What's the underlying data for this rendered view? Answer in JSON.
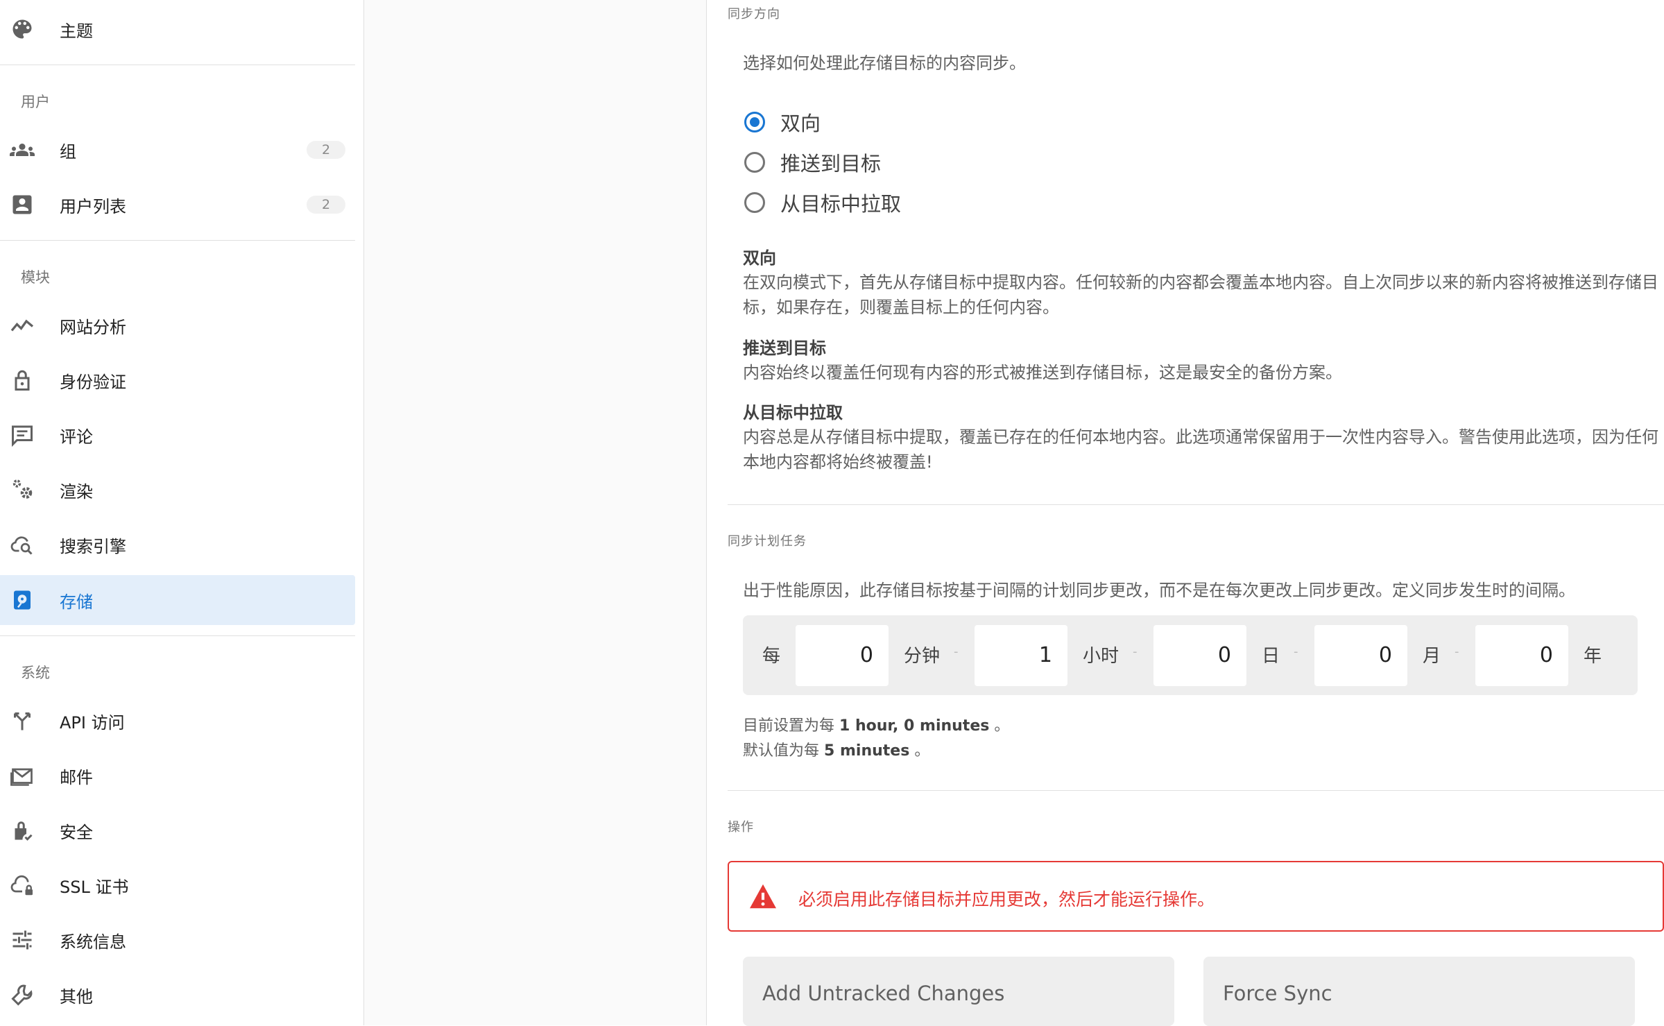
{
  "sidebar": {
    "theme_label": "主题",
    "users_header": "用户",
    "groups_label": "组",
    "groups_count": "2",
    "userlist_label": "用户列表",
    "userlist_count": "2",
    "modules_header": "模块",
    "analytics_label": "网站分析",
    "auth_label": "身份验证",
    "comments_label": "评论",
    "rendering_label": "渲染",
    "search_label": "搜索引擎",
    "storage_label": "存储",
    "system_header": "系统",
    "api_label": "API 访问",
    "mail_label": "邮件",
    "security_label": "安全",
    "ssl_label": "SSL 证书",
    "sysinfo_label": "系统信息",
    "other_label": "其他"
  },
  "sync_direction": {
    "section_title": "同步方向",
    "hint": "选择如何处理此存储目标的内容同步。",
    "options": [
      "双向",
      "推送到目标",
      "从目标中拉取"
    ],
    "selected": "双向",
    "desc_bi_title": "双向",
    "desc_bi_text": "在双向模式下，首先从存储目标中提取内容。任何较新的内容都会覆盖本地内容。自上次同步以来的新内容将被推送到存储目标，如果存在，则覆盖目标上的任何内容。",
    "desc_push_title": "推送到目标",
    "desc_push_text": "内容始终以覆盖任何现有内容的形式被推送到存储目标，这是最安全的备份方案。",
    "desc_pull_title": "从目标中拉取",
    "desc_pull_text": "内容总是从存储目标中提取，覆盖已存在的任何本地内容。此选项通常保留用于一次性内容导入。警告使用此选项，因为任何本地内容都将始终被覆盖!"
  },
  "sync_schedule": {
    "section_title": "同步计划任务",
    "hint": "出于性能原因，此存储目标按基于间隔的计划同步更改，而不是在每次更改上同步更改。定义同步发生时的间隔。",
    "every_label": "每",
    "minutes_value": "0",
    "minutes_label": "分钟",
    "hours_value": "1",
    "hours_label": "小时",
    "days_value": "0",
    "days_label": "日",
    "months_value": "0",
    "months_label": "月",
    "years_value": "0",
    "years_label": "年",
    "dash": "-",
    "current_prefix": "目前设置为每",
    "current_value": "1 hour, 0 minutes",
    "current_suffix": "。",
    "default_prefix": "默认值为每",
    "default_value": "5 minutes",
    "default_suffix": "。"
  },
  "actions": {
    "section_title": "操作",
    "alert_text": "必须启用此存储目标并应用更改，然后才能运行操作。",
    "add_untracked_label": "Add Untracked Changes",
    "force_sync_label": "Force Sync"
  },
  "colors": {
    "accent": "#1976d2",
    "active_bg": "#e3eefa",
    "error": "#e53935"
  }
}
